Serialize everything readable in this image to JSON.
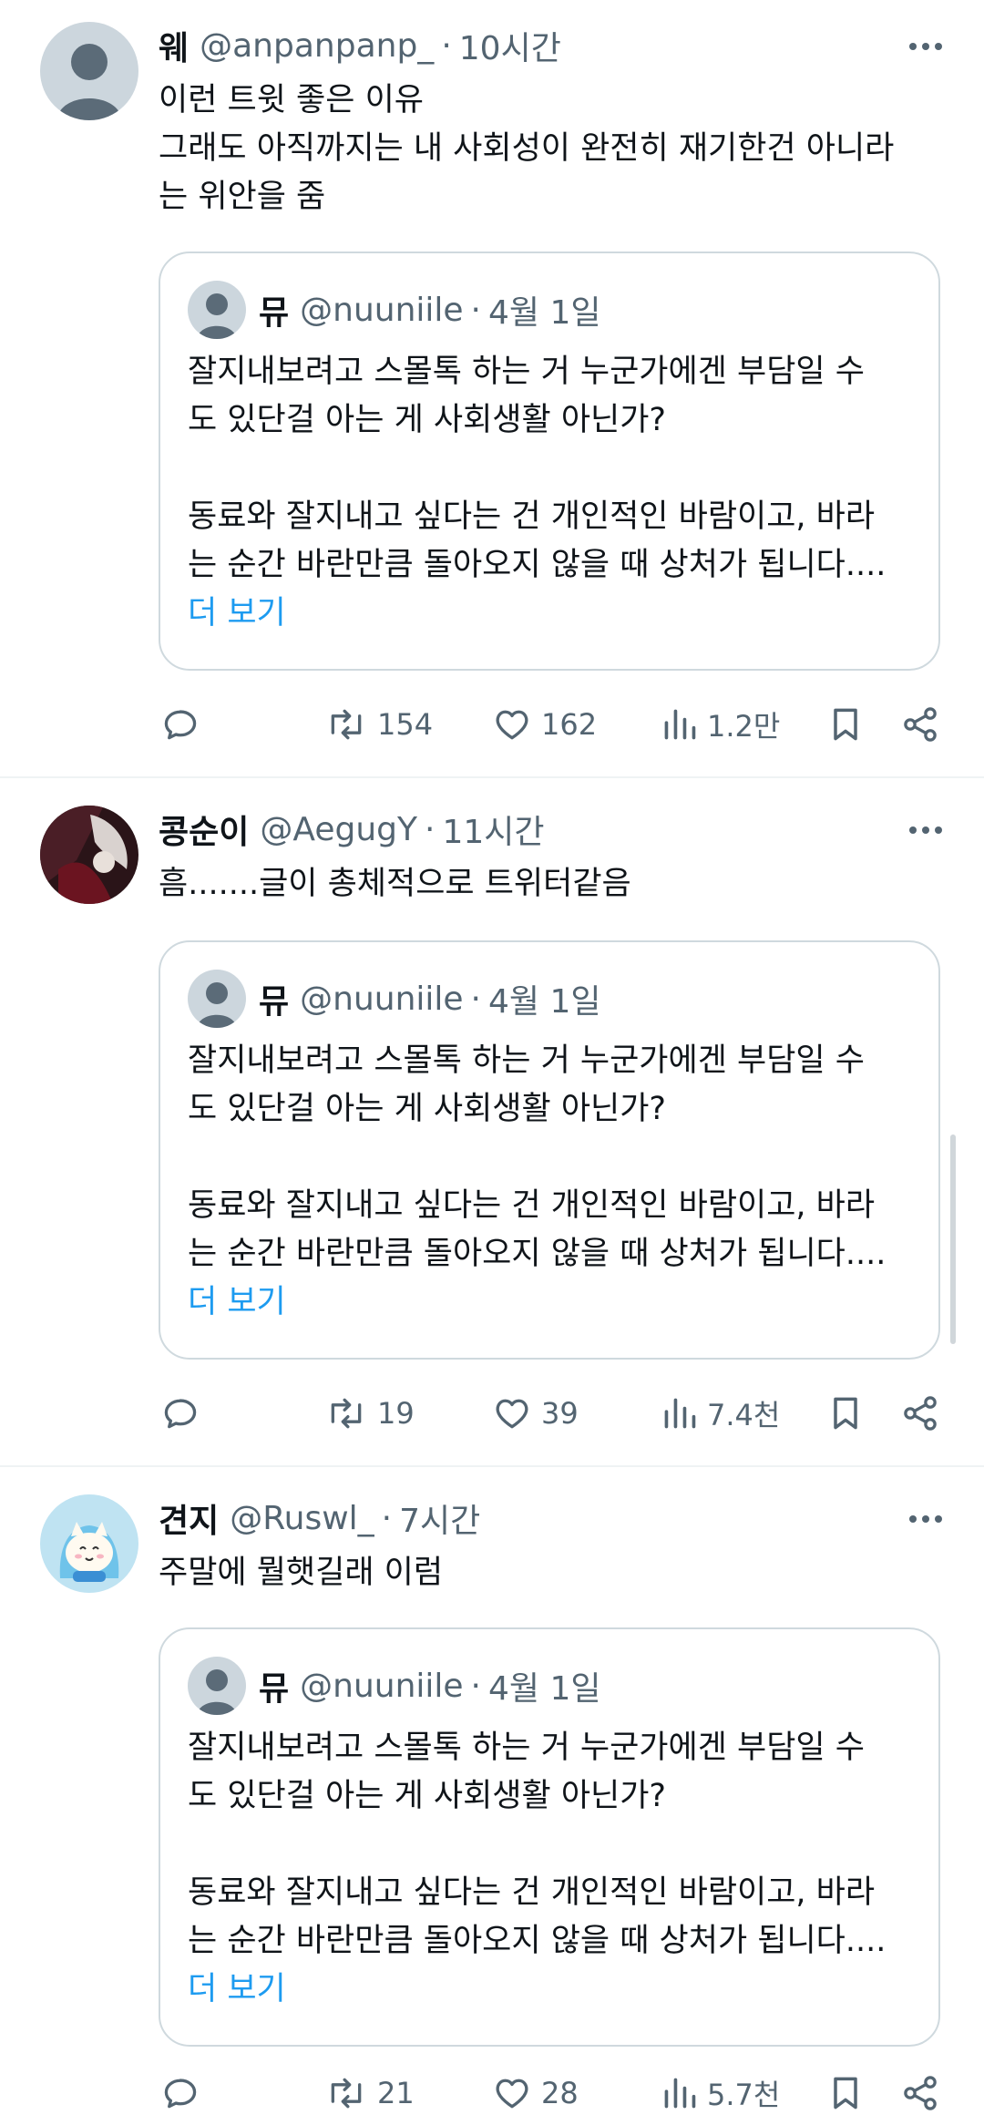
{
  "tweets": [
    {
      "name": "웨",
      "handle": "@anpanpanp_",
      "time": "10시간",
      "text_lines": [
        "이런 트윗 좋은 이유",
        "그래도 아직까지는 내 사회성이 완전히 재기한건 아니라",
        "는 위안을 줌"
      ],
      "quote": {
        "name": "뮤",
        "handle": "@nuuniile",
        "time": "4월 1일",
        "lines": [
          "잘지내보려고 스몰톡 하는 거 누군가에겐 부담일 수",
          "도 있단걸 아는 게 사회생활 아닌가?",
          "",
          "동료와 잘지내고 싶다는 건 개인적인 바람이고, 바라",
          "는 순간 바란만큼 돌아오지 않을 때 상처가 됩니다...."
        ],
        "show_more": "더 보기"
      },
      "stats": {
        "retweets": "154",
        "likes": "162",
        "views": "1.2만"
      }
    },
    {
      "name": "콩순이",
      "handle": "@AegugY",
      "time": "11시간",
      "text_lines": [
        "흠.......글이 총체적으로 트위터같음"
      ],
      "quote": {
        "name": "뮤",
        "handle": "@nuuniile",
        "time": "4월 1일",
        "lines": [
          "잘지내보려고 스몰톡 하는 거 누군가에겐 부담일 수",
          "도 있단걸 아는 게 사회생활 아닌가?",
          "",
          "동료와 잘지내고 싶다는 건 개인적인 바람이고, 바라",
          "는 순간 바란만큼 돌아오지 않을 때 상처가 됩니다...."
        ],
        "show_more": "더 보기"
      },
      "stats": {
        "retweets": "19",
        "likes": "39",
        "views": "7.4천"
      }
    },
    {
      "name": "견지",
      "handle": "@Ruswl_",
      "time": "7시간",
      "text_lines": [
        "주말에 뭘햇길래 이럼"
      ],
      "quote": {
        "name": "뮤",
        "handle": "@nuuniile",
        "time": "4월 1일",
        "lines": [
          "잘지내보려고 스몰톡 하는 거 누군가에겐 부담일 수",
          "도 있단걸 아는 게 사회생활 아닌가?",
          "",
          "동료와 잘지내고 싶다는 건 개인적인 바람이고, 바라",
          "는 순간 바란만큼 돌아오지 않을 때 상처가 됩니다...."
        ],
        "show_more": "더 보기"
      },
      "stats": {
        "retweets": "21",
        "likes": "28",
        "views": "5.7천"
      }
    }
  ],
  "colors": {
    "text": "#0f1419",
    "secondary": "#536471",
    "link": "#1d9bf0",
    "border": "#cfd9de"
  }
}
